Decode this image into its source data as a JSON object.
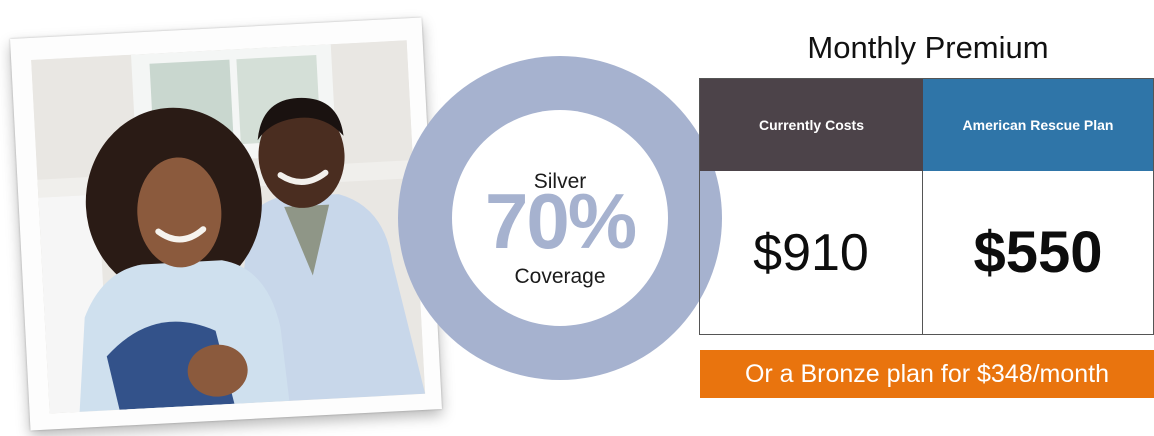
{
  "coverage": {
    "tier": "Silver",
    "percent": "70%",
    "label": "Coverage",
    "ring_color": "#a6b2cf"
  },
  "premium": {
    "title": "Monthly Premium",
    "columns": [
      {
        "header": "Currently Costs",
        "value": "$910",
        "color": "#4c4349"
      },
      {
        "header": "American Rescue Plan",
        "value": "$550",
        "color": "#2f75a8"
      }
    ]
  },
  "bronze_banner": {
    "text": "Or a Bronze plan for $348/month",
    "color": "#e9740e"
  }
}
